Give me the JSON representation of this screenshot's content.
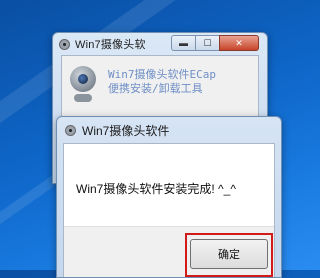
{
  "back_window": {
    "title": "Win7摄像头软",
    "controls": {
      "min": "▬",
      "max": "☐",
      "close": "✕"
    },
    "app_line1": "Win7摄像头软件ECap",
    "app_line2": "便携安装/卸载工具"
  },
  "dialog": {
    "title": "Win7摄像头软件",
    "message": "Win7摄像头软件安装完成! ^_^",
    "ok_label": "确定"
  },
  "colors": {
    "desktop": "#0e66c8",
    "highlight": "#d11a1a"
  }
}
